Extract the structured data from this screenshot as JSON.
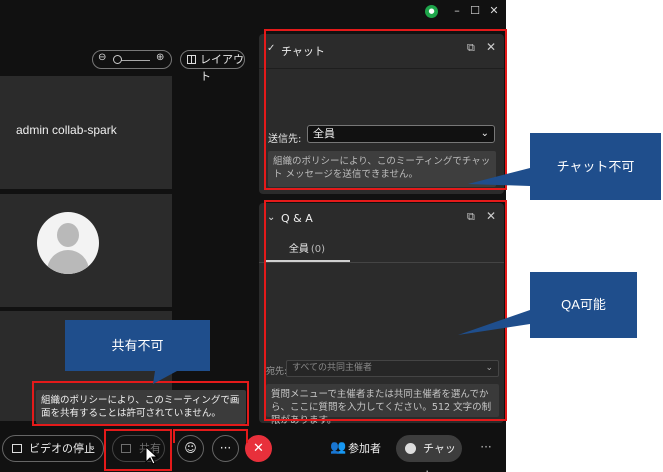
{
  "window": {
    "controls": {
      "minimize": "–",
      "maximize": "☐",
      "close": "✕"
    }
  },
  "stage": {
    "zoom": {
      "minus": "⊖",
      "plus": "⊕"
    },
    "layout_label": "レイアウト",
    "tiles": [
      {
        "name": "admin collab-spark"
      }
    ]
  },
  "share_tooltip": "組織のポリシーにより、このミーティングで画面を共有することは許可されていません。",
  "toolbar": {
    "video_label": "ビデオの停止",
    "share_label": "共有",
    "more_label": "···",
    "participants_label": "参加者",
    "chat_label": "チャット",
    "overflow_label": "···"
  },
  "chat_panel": {
    "title": "チャット",
    "to_label": "送信先:",
    "to_value": "全員",
    "policy_message": "組織のポリシーにより、このミーティングでチャット メッセージを送信できません。"
  },
  "qa_panel": {
    "title": "Q & A",
    "tab_label": "全員",
    "tab_count": "(0)",
    "to_label": "宛先:",
    "to_value": "すべての共同主催者",
    "input_placeholder": "質問メニューで主催者または共同主催者を選んでから、ここに質問を入力してください。512 文字の制限があります。"
  },
  "annotations": {
    "chat_disabled": "チャット不可",
    "qa_enabled": "QA可能",
    "share_disabled": "共有不可"
  },
  "colors": {
    "highlight": "#e41a1a",
    "callout": "#1f4e8c",
    "end_call": "#e8303b",
    "app_background": "#111111",
    "panel_background": "#2b2b2b"
  }
}
